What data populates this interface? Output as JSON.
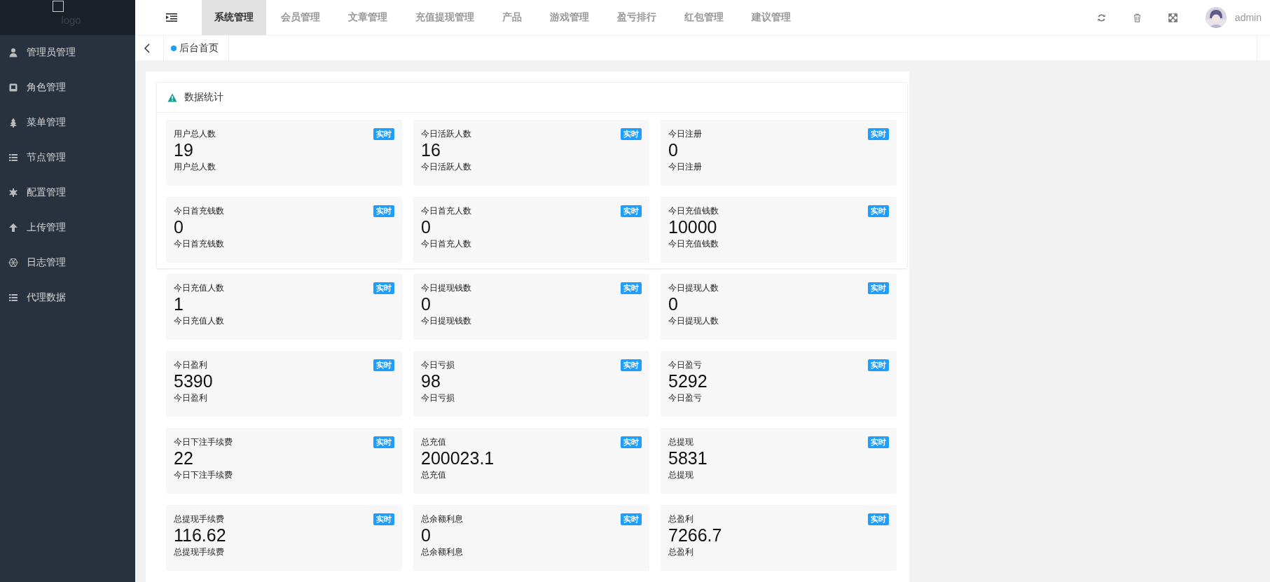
{
  "logo": {
    "text": "logo"
  },
  "sidebar": {
    "items": [
      {
        "label": "管理员管理"
      },
      {
        "label": "角色管理"
      },
      {
        "label": "菜单管理"
      },
      {
        "label": "节点管理"
      },
      {
        "label": "配置管理"
      },
      {
        "label": "上传管理"
      },
      {
        "label": "日志管理"
      },
      {
        "label": "代理数据"
      }
    ]
  },
  "top_nav": {
    "tabs": [
      {
        "label": "系统管理",
        "selected": true
      },
      {
        "label": "会员管理",
        "selected": false
      },
      {
        "label": "文章管理",
        "selected": false
      },
      {
        "label": "充值提现管理",
        "selected": false
      },
      {
        "label": "产品",
        "selected": false
      },
      {
        "label": "游戏管理",
        "selected": false
      },
      {
        "label": "盈亏排行",
        "selected": false
      },
      {
        "label": "红包管理",
        "selected": false
      },
      {
        "label": "建议管理",
        "selected": false
      }
    ],
    "user": "admin"
  },
  "page_tabs": [
    {
      "label": "后台首页",
      "selected": true
    }
  ],
  "stats": {
    "title": "数据统计",
    "cards": [
      {
        "title": "用户总人数",
        "badge": "实时",
        "value": "19",
        "footer": "用户总人数"
      },
      {
        "title": "今日活跃人数",
        "badge": "实时",
        "value": "16",
        "footer": "今日活跃人数"
      },
      {
        "title": "今日注册",
        "badge": "实时",
        "value": "0",
        "footer": "今日注册"
      },
      {
        "title": "今日首充钱数",
        "badge": "实时",
        "value": "0",
        "footer": "今日首充钱数"
      },
      {
        "title": "今日首充人数",
        "badge": "实时",
        "value": "0",
        "footer": "今日首充人数"
      },
      {
        "title": "今日充值钱数",
        "badge": "实时",
        "value": "10000",
        "footer": "今日充值钱数"
      },
      {
        "title": "今日充值人数",
        "badge": "实时",
        "value": "1",
        "footer": "今日充值人数"
      },
      {
        "title": "今日提现钱数",
        "badge": "实时",
        "value": "0",
        "footer": "今日提现钱数"
      },
      {
        "title": "今日提现人数",
        "badge": "实时",
        "value": "0",
        "footer": "今日提现人数"
      },
      {
        "title": "今日盈利",
        "badge": "实时",
        "value": "5390",
        "footer": "今日盈利"
      },
      {
        "title": "今日亏损",
        "badge": "实时",
        "value": "98",
        "footer": "今日亏损"
      },
      {
        "title": "今日盈亏",
        "badge": "实时",
        "value": "5292",
        "footer": "今日盈亏"
      },
      {
        "title": "今日下注手续费",
        "badge": "实时",
        "value": "22",
        "footer": "今日下注手续费"
      },
      {
        "title": "总充值",
        "badge": "实时",
        "value": "200023.1",
        "footer": "总充值"
      },
      {
        "title": "总提现",
        "badge": "实时",
        "value": "5831",
        "footer": "总提现"
      },
      {
        "title": "总提现手续费",
        "badge": "实时",
        "value": "116.62",
        "footer": "总提现手续费"
      },
      {
        "title": "总余额利息",
        "badge": "实时",
        "value": "0",
        "footer": "总余额利息"
      },
      {
        "title": "总盈利",
        "badge": "实时",
        "value": "7266.7",
        "footer": "总盈利"
      }
    ]
  }
}
